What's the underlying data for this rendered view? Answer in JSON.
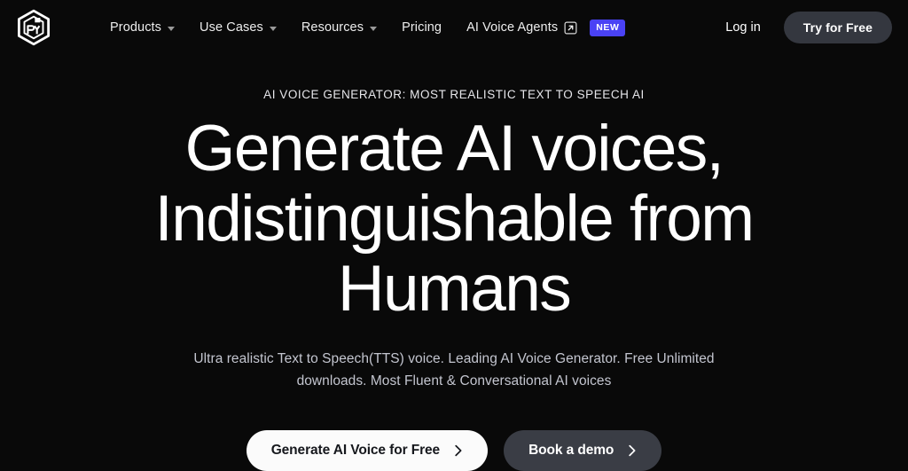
{
  "theme": {
    "background": "#090909",
    "text_primary": "#ffffff",
    "text_muted": "#c3c5cf",
    "badge_accent": "#4a42f5",
    "button_secondary_bg": "#3a3d45",
    "button_primary_bg": "#fbfbfb",
    "header_button_bg": "#34373f"
  },
  "header": {
    "logo_name": "cube-logo",
    "nav": [
      {
        "label": "Products",
        "has_caret": true,
        "has_external": false,
        "badge": null,
        "icon": "chevron-down-icon"
      },
      {
        "label": "Use Cases",
        "has_caret": true,
        "has_external": false,
        "badge": null,
        "icon": "chevron-down-icon"
      },
      {
        "label": "Resources",
        "has_caret": true,
        "has_external": false,
        "badge": null,
        "icon": "chevron-down-icon"
      },
      {
        "label": "Pricing",
        "has_caret": false,
        "has_external": false,
        "badge": null,
        "icon": null
      },
      {
        "label": "AI Voice Agents",
        "has_caret": false,
        "has_external": true,
        "badge": "NEW",
        "icon": "external-link-icon"
      }
    ],
    "login_label": "Log in",
    "try_free_label": "Try for Free"
  },
  "hero": {
    "eyebrow": "AI VOICE GENERATOR: MOST REALISTIC TEXT TO SPEECH AI",
    "headline_line1": "Generate AI voices,",
    "headline_line2": "Indistinguishable from",
    "headline_line3": "Humans",
    "subheadline": "Ultra realistic Text to Speech(TTS) voice. Leading AI Voice Generator. Free Unlimited downloads. Most Fluent & Conversational AI voices",
    "cta_primary": "Generate AI Voice for Free",
    "cta_secondary": "Book a demo",
    "cta_icon": "chevron-right-icon"
  }
}
